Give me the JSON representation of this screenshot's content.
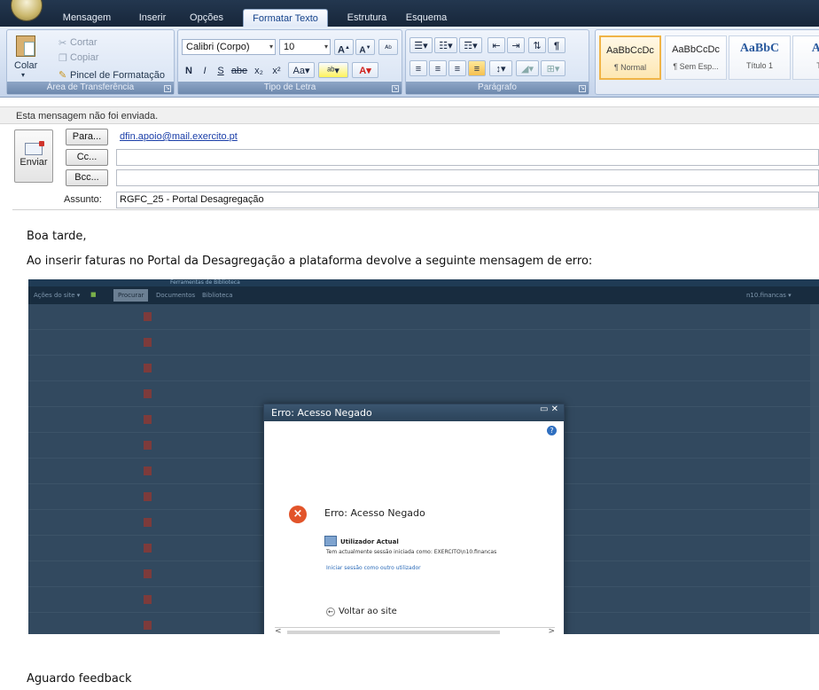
{
  "ribbon": {
    "tabs": [
      "Mensagem",
      "Inserir",
      "Opções",
      "Formatar Texto",
      "Estrutura",
      "Esquema"
    ],
    "clipboard": {
      "paste": "Colar",
      "cut": "Cortar",
      "copy": "Copiar",
      "format_painter": "Pincel de Formatação",
      "label": "Área de Transferência"
    },
    "font": {
      "family": "Calibri (Corpo)",
      "size": "10",
      "label": "Tipo de Letra"
    },
    "paragraph": {
      "label": "Parágrafo"
    },
    "styles": [
      {
        "sample": "AaBbCcDc",
        "name": "¶ Normal"
      },
      {
        "sample": "AaBbCcDc",
        "name": "¶ Sem Esp..."
      },
      {
        "sample": "AaBbC",
        "name": "Título 1"
      },
      {
        "sample": "AaB",
        "name": "Títu"
      }
    ],
    "accent": "#15428b"
  },
  "info_bar": "Esta mensagem não foi enviada.",
  "header": {
    "send": "Enviar",
    "to_button": "Para...",
    "to_value": "dfin.apoio@mail.exercito.pt",
    "cc_button": "Cc...",
    "cc_value": "",
    "bcc_button": "Bcc...",
    "bcc_value": "",
    "subject_label": "Assunto:",
    "subject_value": "RGFC_25 - Portal Desagregação"
  },
  "body": {
    "greeting": "Boa tarde,",
    "text": "Ao inserir faturas no Portal da Desagregação a plataforma devolve a seguinte mensagem de  erro:",
    "closing": "Aguardo feedback"
  },
  "screenshot": {
    "nav_left": "Ações do site ▾",
    "nav_tab": "Procurar",
    "tab_documents": "Documentos",
    "tab_library": "Biblioteca",
    "tools": "Ferramentas de Biblioteca",
    "user": "n10.financas ▾",
    "dialog": {
      "title": "Erro: Acesso Negado",
      "controls": "▭ ✕",
      "help": "?",
      "heading": "Erro: Acesso Negado",
      "user_label": "Utilizador Actual",
      "session_text": "Tem actualmente sessão iniciada como:  EXERCITO\\n10.financas",
      "login_link": "Iniciar sessão como outro utilizador",
      "back": "Voltar ao site",
      "scroll_left": "<",
      "scroll_right": ">"
    }
  }
}
